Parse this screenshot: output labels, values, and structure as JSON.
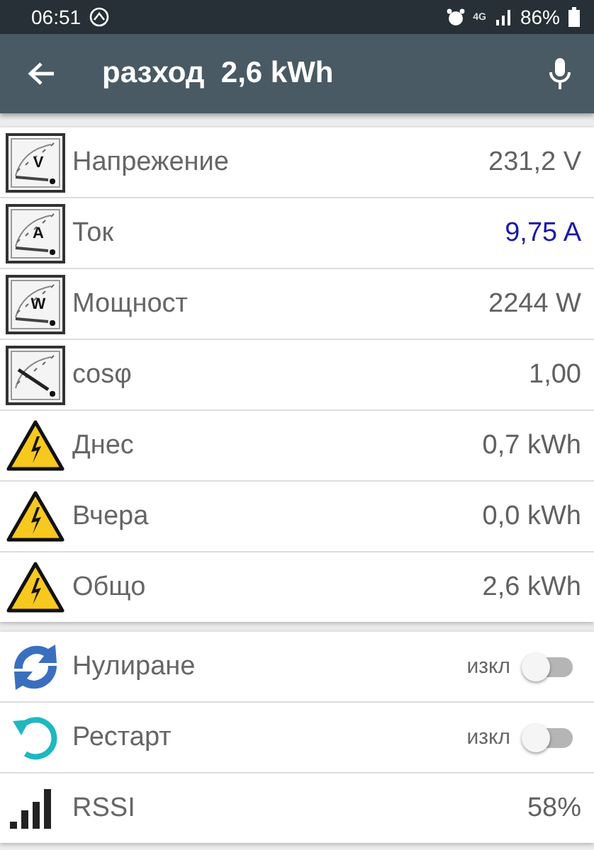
{
  "status_bar": {
    "time": "06:51",
    "network": "4G",
    "battery": "86%"
  },
  "app_bar": {
    "title": "разход  2,6 kWh"
  },
  "groups": [
    {
      "rows": [
        {
          "kind": "value",
          "dial": "V",
          "label": "Напрежение",
          "value": "231,2 V",
          "color": "#616161"
        },
        {
          "kind": "value",
          "dial": "A",
          "label": "Ток",
          "value": "9,75 A",
          "color": "#1a1aa6"
        },
        {
          "kind": "value",
          "dial": "W",
          "label": "Мощност",
          "value": "2244 W",
          "color": "#616161"
        },
        {
          "kind": "value",
          "label": "cosφ",
          "value": "1,00",
          "color": "#616161"
        },
        {
          "kind": "value",
          "label": "Днес",
          "value": "0,7 kWh",
          "color": "#616161"
        },
        {
          "kind": "value",
          "label": "Вчера",
          "value": "0,0 kWh",
          "color": "#616161"
        },
        {
          "kind": "value",
          "label": "Общо",
          "value": "2,6 kWh",
          "color": "#616161"
        }
      ]
    },
    {
      "rows": [
        {
          "kind": "switch",
          "label": "Нулиране",
          "state_label": "изкл",
          "on": false
        },
        {
          "kind": "switch",
          "label": "Рестарт",
          "state_label": "изкл",
          "on": false
        },
        {
          "kind": "value",
          "label": "RSSI",
          "value": "58%",
          "color": "#616161"
        }
      ]
    }
  ]
}
